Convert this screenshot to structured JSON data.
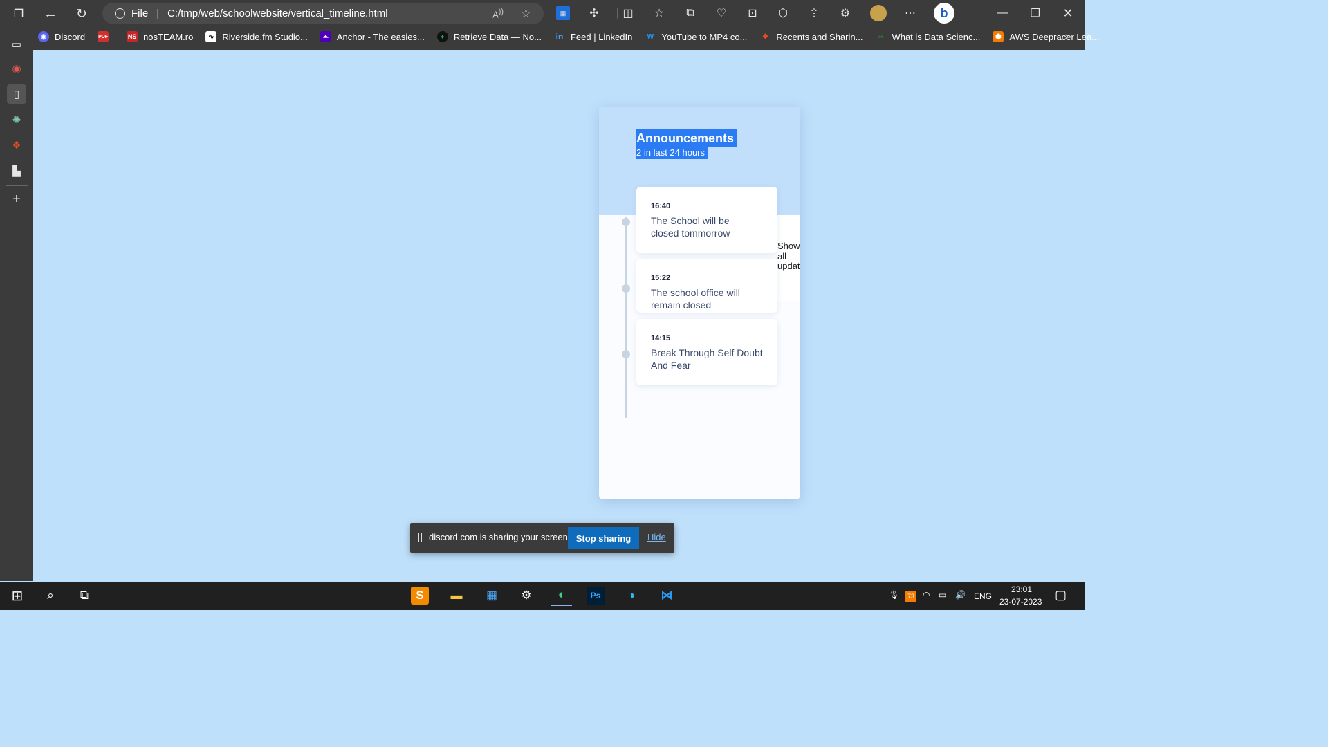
{
  "browser": {
    "file_label": "File",
    "url": "C:/tmp/web/schoolwebsite/vertical_timeline.html",
    "bookmarks": [
      {
        "label": "Discord",
        "icon": "discord-icon",
        "color": "#5865f2"
      },
      {
        "label": "",
        "icon": "pdf-icon",
        "color": "#d32f2f"
      },
      {
        "label": "nosTEAM.ro",
        "icon": "nosteam-icon",
        "color": "#e53935"
      },
      {
        "label": "Riverside.fm Studio...",
        "icon": "riverside-icon",
        "color": "#ffffff"
      },
      {
        "label": "Anchor - The easies...",
        "icon": "anchor-icon",
        "color": "#5000b9"
      },
      {
        "label": "Retrieve Data — No...",
        "icon": "mongodb-icon",
        "color": "#13aa52"
      },
      {
        "label": "Feed | LinkedIn",
        "icon": "linkedin-icon",
        "color": "#0a66c2"
      },
      {
        "label": "YouTube to MP4 co...",
        "icon": "youtube-mp4-icon",
        "color": "#2196f3"
      },
      {
        "label": "Recents and Sharin...",
        "icon": "figma-icon",
        "color": "#f24e1e"
      },
      {
        "label": "What is Data Scienc...",
        "icon": "datascience-icon",
        "color": "#2e7d32"
      },
      {
        "label": "AWS Deepracer Lea...",
        "icon": "aws-icon",
        "color": "#f90"
      }
    ]
  },
  "card": {
    "title": "Announcements",
    "subtitle": "2 in last 24 hours",
    "show_all": "Show all updat",
    "items": [
      {
        "time": "16:40",
        "text": "The School will be closed tommorrow"
      },
      {
        "time": "15:22",
        "text": "The school office will remain closed"
      },
      {
        "time": "14:15",
        "text": "Break Through Self Doubt And Fear"
      }
    ]
  },
  "toast": {
    "message": "discord.com is sharing your screen.",
    "stop_label": "Stop sharing",
    "hide_label": "Hide"
  },
  "taskbar": {
    "language": "ENG",
    "time": "23:01",
    "date": "23-07-2023",
    "badge": "73"
  },
  "colors": {
    "page_bg": "#bfe0fb",
    "selection": "#2b7cf4",
    "stop_button": "#0f6cbd"
  }
}
